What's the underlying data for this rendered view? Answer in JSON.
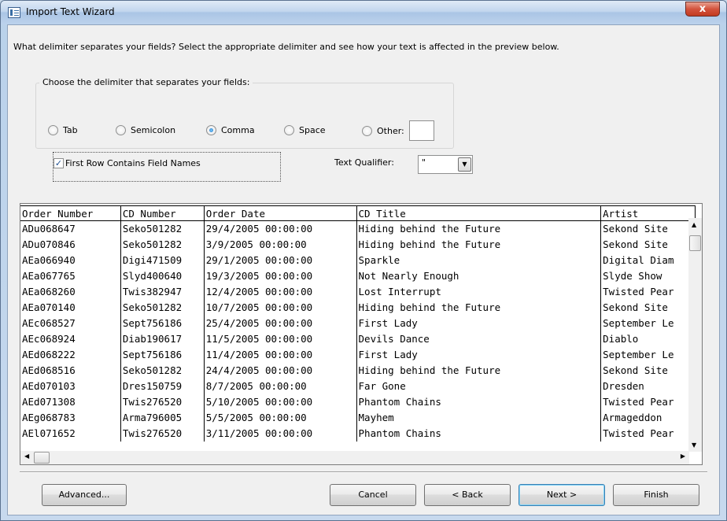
{
  "window": {
    "title": "Import Text Wizard",
    "close_label": "x"
  },
  "instruction": "What delimiter separates your fields? Select the appropriate delimiter and see how your text is affected in the preview below.",
  "delimiter": {
    "legend": "Choose the delimiter that separates your fields:",
    "options": [
      {
        "label": "Tab",
        "checked": false
      },
      {
        "label": "Semicolon",
        "checked": false
      },
      {
        "label": "Comma",
        "checked": true
      },
      {
        "label": "Space",
        "checked": false
      },
      {
        "label": "Other:",
        "checked": false
      }
    ],
    "other_value": ""
  },
  "first_row": {
    "label": "First Row Contains Field Names",
    "checked": true,
    "check_mark": "✓"
  },
  "qualifier": {
    "label": "Text Qualifier:",
    "value": "\""
  },
  "table": {
    "headers": [
      "Order Number",
      "CD Number",
      "Order Date",
      "CD Title",
      "Artist"
    ],
    "rows": [
      [
        "ADu068647",
        "Seko501282",
        "29/4/2005 00:00:00",
        "Hiding behind the Future",
        "Sekond Site"
      ],
      [
        "ADu070846",
        "Seko501282",
        "3/9/2005 00:00:00",
        "Hiding behind the Future",
        "Sekond Site"
      ],
      [
        "AEa066940",
        "Digi471509",
        "29/1/2005 00:00:00",
        "Sparkle",
        "Digital Diam"
      ],
      [
        "AEa067765",
        "Slyd400640",
        "19/3/2005 00:00:00",
        "Not Nearly Enough",
        "Slyde Show"
      ],
      [
        "AEa068260",
        "Twis382947",
        "12/4/2005 00:00:00",
        "Lost Interrupt",
        "Twisted Pear"
      ],
      [
        "AEa070140",
        "Seko501282",
        "10/7/2005 00:00:00",
        "Hiding behind the Future",
        "Sekond Site"
      ],
      [
        "AEc068527",
        "Sept756186",
        "25/4/2005 00:00:00",
        "First Lady",
        "September Le"
      ],
      [
        "AEc068924",
        "Diab190617",
        "11/5/2005 00:00:00",
        "Devils Dance",
        "Diablo"
      ],
      [
        "AEd068222",
        "Sept756186",
        "11/4/2005 00:00:00",
        "First Lady",
        "September Le"
      ],
      [
        "AEd068516",
        "Seko501282",
        "24/4/2005 00:00:00",
        "Hiding behind the Future",
        "Sekond Site"
      ],
      [
        "AEd070103",
        "Dres150759",
        "8/7/2005 00:00:00",
        "Far Gone",
        "Dresden"
      ],
      [
        "AEd071308",
        "Twis276520",
        "5/10/2005 00:00:00",
        "Phantom Chains",
        "Twisted Pear"
      ],
      [
        "AEg068783",
        "Arma796005",
        "5/5/2005 00:00:00",
        "Mayhem",
        "Armageddon"
      ],
      [
        "AEl071652",
        "Twis276520",
        "3/11/2005 00:00:00",
        "Phantom Chains",
        "Twisted Pear"
      ]
    ]
  },
  "buttons": {
    "advanced": "Advanced...",
    "cancel": "Cancel",
    "back": "< Back",
    "next": "Next >",
    "finish": "Finish"
  },
  "icons": {
    "app": "import-text-icon",
    "scroll_up": "▲",
    "scroll_down": "▼",
    "scroll_left": "◀",
    "scroll_right": "▶",
    "dropdown": "▼"
  }
}
